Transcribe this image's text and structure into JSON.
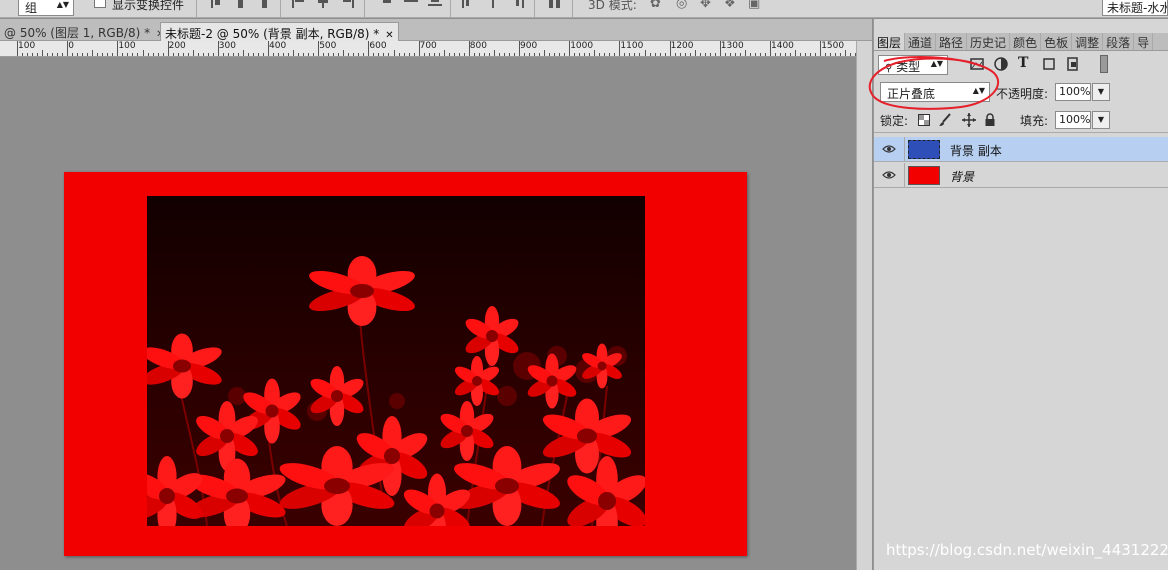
{
  "options_bar": {
    "auto_select_value": "组",
    "show_transform_label": "显示变换控件",
    "mode_3d_label": "3D 模式:",
    "document_title": "未标题-水水"
  },
  "tabs": [
    {
      "label": "@ 50% (图层 1, RGB/8) *"
    },
    {
      "label": "未标题-2 @ 50% (背景 副本, RGB/8) *"
    }
  ],
  "ruler": {
    "labels": [
      "100",
      "0",
      "100",
      "200",
      "300",
      "400",
      "500",
      "600",
      "700",
      "800",
      "900",
      "1000",
      "1100",
      "1200",
      "1300",
      "1400",
      "1500"
    ]
  },
  "layers_panel": {
    "tabs": [
      "图层",
      "通道",
      "路径",
      "历史记",
      "颜色",
      "色板",
      "调整",
      "段落",
      "导"
    ],
    "filter_value": "类型",
    "blend_mode": "正片叠底",
    "opacity_label": "不透明度:",
    "opacity_value": "100%",
    "lock_label": "锁定:",
    "fill_label": "填充:",
    "fill_value": "100%",
    "layers": [
      {
        "name": "背景 副本",
        "selected": true,
        "thumb_color": "#2f4fb8"
      },
      {
        "name": "背景",
        "selected": false,
        "thumb_color": "#f20000"
      }
    ]
  },
  "colors": {
    "canvas_red": "#f20000",
    "annotation_red": "#e5202a",
    "selection_blue": "#b7cff1"
  },
  "watermark": "https://blog.csdn.net/weixin_44312227"
}
